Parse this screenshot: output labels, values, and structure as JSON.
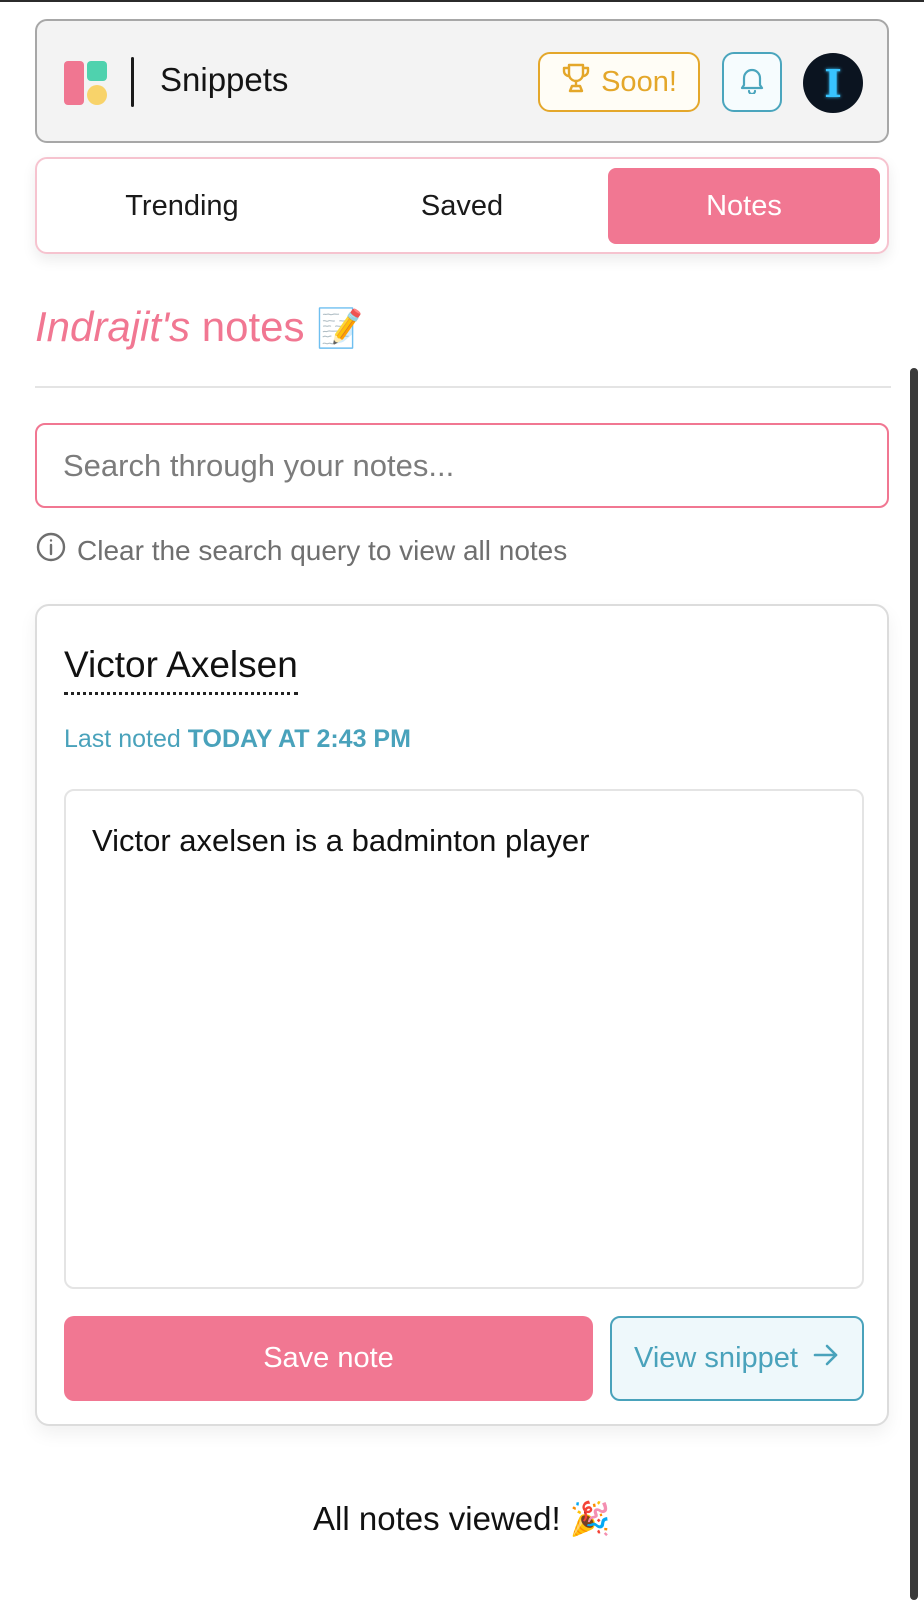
{
  "header": {
    "app_title": "Snippets",
    "soon_label": "Soon!",
    "soon_icon": "trophy-icon",
    "bell_icon": "bell-icon",
    "avatar_letter": "I"
  },
  "tabs": [
    {
      "label": "Trending",
      "active": false
    },
    {
      "label": "Saved",
      "active": false
    },
    {
      "label": "Notes",
      "active": true
    }
  ],
  "page": {
    "owner": "Indrajit's",
    "heading_rest": "notes",
    "heading_emoji": "📝"
  },
  "search": {
    "placeholder": "Search through your notes...",
    "value": "",
    "hint": "Clear the search query to view all notes"
  },
  "note": {
    "title": "Victor Axelsen",
    "last_noted_prefix": "Last noted",
    "last_noted_when": "TODAY AT 2:43 PM",
    "body": "Victor axelsen is a badminton player",
    "save_label": "Save note",
    "view_label": "View snippet"
  },
  "footer": {
    "text": "All notes viewed!",
    "emoji": "🎉"
  },
  "colors": {
    "accent_pink": "#f17792",
    "accent_teal": "#49a2bb",
    "accent_gold": "#e4a72a"
  }
}
